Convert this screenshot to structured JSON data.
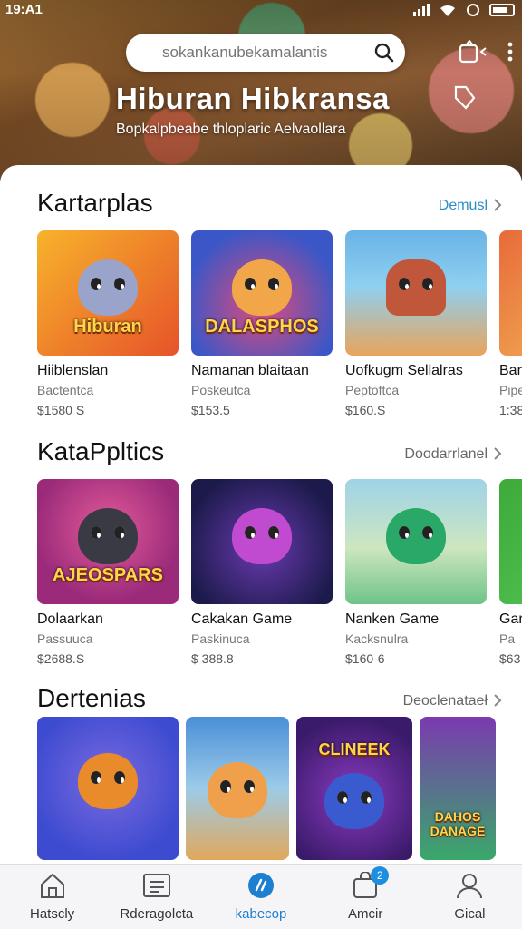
{
  "status_bar": {
    "time": "19:A1"
  },
  "header": {
    "search_placeholder": "sokankanubekamalantis",
    "title": "Hiburan   Hibkransa",
    "subtitle": "Bopkalpbeabe thloplaric Aelvaollara"
  },
  "sections": [
    {
      "title": "Kartarplas",
      "more": "Demusl",
      "cards": [
        {
          "name": "Hiiblenslan",
          "sub": "Bactentca",
          "price": "$1580 S",
          "thumb_text": "Hiburan",
          "colors": [
            "#f7b32b",
            "#e6532a"
          ]
        },
        {
          "name": "Namanan blaitaan",
          "sub": "Poskeutca",
          "price": "$153.5",
          "thumb_text": "DALASPHOS",
          "colors": [
            "#3b57c7",
            "#e04a7a"
          ]
        },
        {
          "name": "Uofkugm Sellalras",
          "sub": "Peptoftca",
          "price": "$160.S",
          "thumb_text": "",
          "colors": [
            "#69b3e6",
            "#e8a45b"
          ]
        },
        {
          "name": "Ban",
          "sub": "Pipe",
          "price": "1:38",
          "thumb_text": "",
          "colors": [
            "#e86a3a",
            "#f3c25c"
          ]
        }
      ]
    },
    {
      "title": "KataPpltics",
      "more": "Doodarrlanel",
      "cards": [
        {
          "name": "Dolaarkan",
          "sub": "Passuuca",
          "price": "$2688.S",
          "thumb_text": "AJEOSPARS",
          "colors": [
            "#9b2b7a",
            "#e35a3a"
          ]
        },
        {
          "name": "Cakakan Game",
          "sub": "Paskinuca",
          "price": "$ 388.8",
          "thumb_text": "",
          "colors": [
            "#2b2a7a",
            "#c04ad0"
          ]
        },
        {
          "name": "Nanken Game",
          "sub": "Kacksnulra",
          "price": "$160-6",
          "thumb_text": "",
          "colors": [
            "#6fc38a",
            "#2aa868"
          ]
        },
        {
          "name": "Gar",
          "sub": "Pa",
          "price": "$63",
          "thumb_text": "",
          "colors": [
            "#3daa3a",
            "#58c95a"
          ]
        }
      ]
    },
    {
      "title": "Dertenias",
      "more": "Deoclenataeł",
      "cards": [
        {
          "name": "",
          "sub": "",
          "price": "",
          "thumb_text": "",
          "colors": [
            "#3d4bd0",
            "#e98a2b"
          ]
        },
        {
          "name": "",
          "sub": "",
          "price": "",
          "thumb_text": "",
          "colors": [
            "#4a8fd8",
            "#e0a85b"
          ]
        },
        {
          "name": "",
          "sub": "",
          "price": "",
          "thumb_text": "CLINEEK",
          "colors": [
            "#5a2a9a",
            "#e8a83a"
          ]
        },
        {
          "name": "",
          "sub": "",
          "price": "",
          "thumb_text": "DAHOS DANAGE",
          "colors": [
            "#7a3ab0",
            "#3aa86a"
          ]
        }
      ]
    }
  ],
  "bottom_nav": [
    {
      "label": "Hatscly",
      "icon": "home-icon"
    },
    {
      "label": "Rderagolcta",
      "icon": "list-icon"
    },
    {
      "label": "kabecop",
      "icon": "apps-icon",
      "active": true
    },
    {
      "label": "Amcir",
      "icon": "bag-icon",
      "badge": "2"
    },
    {
      "label": "Gical",
      "icon": "user-icon"
    }
  ],
  "colors": {
    "accent": "#1d7fcf",
    "link": "#2a8ec9"
  }
}
